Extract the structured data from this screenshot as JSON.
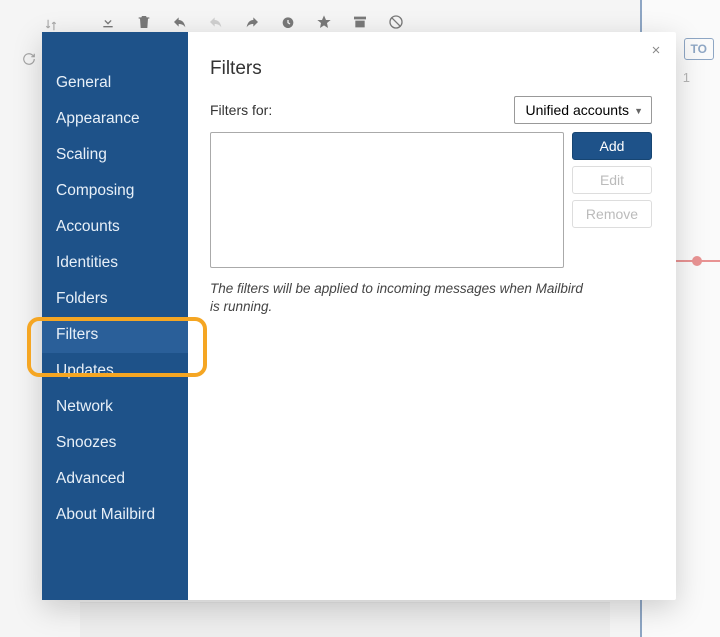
{
  "background": {
    "today_button": "TO",
    "today_num": "1"
  },
  "modal": {
    "sidebar": {
      "items": [
        {
          "label": "General"
        },
        {
          "label": "Appearance"
        },
        {
          "label": "Scaling"
        },
        {
          "label": "Composing"
        },
        {
          "label": "Accounts"
        },
        {
          "label": "Identities"
        },
        {
          "label": "Folders"
        },
        {
          "label": "Filters",
          "selected": true
        },
        {
          "label": "Updates"
        },
        {
          "label": "Network"
        },
        {
          "label": "Snoozes"
        },
        {
          "label": "Advanced"
        },
        {
          "label": "About Mailbird"
        }
      ]
    },
    "content": {
      "title": "Filters",
      "filters_for_label": "Filters for:",
      "account_selected": "Unified accounts",
      "buttons": {
        "add": "Add",
        "edit": "Edit",
        "remove": "Remove"
      },
      "note": "The filters will be applied to incoming messages when Mailbird is running."
    }
  }
}
